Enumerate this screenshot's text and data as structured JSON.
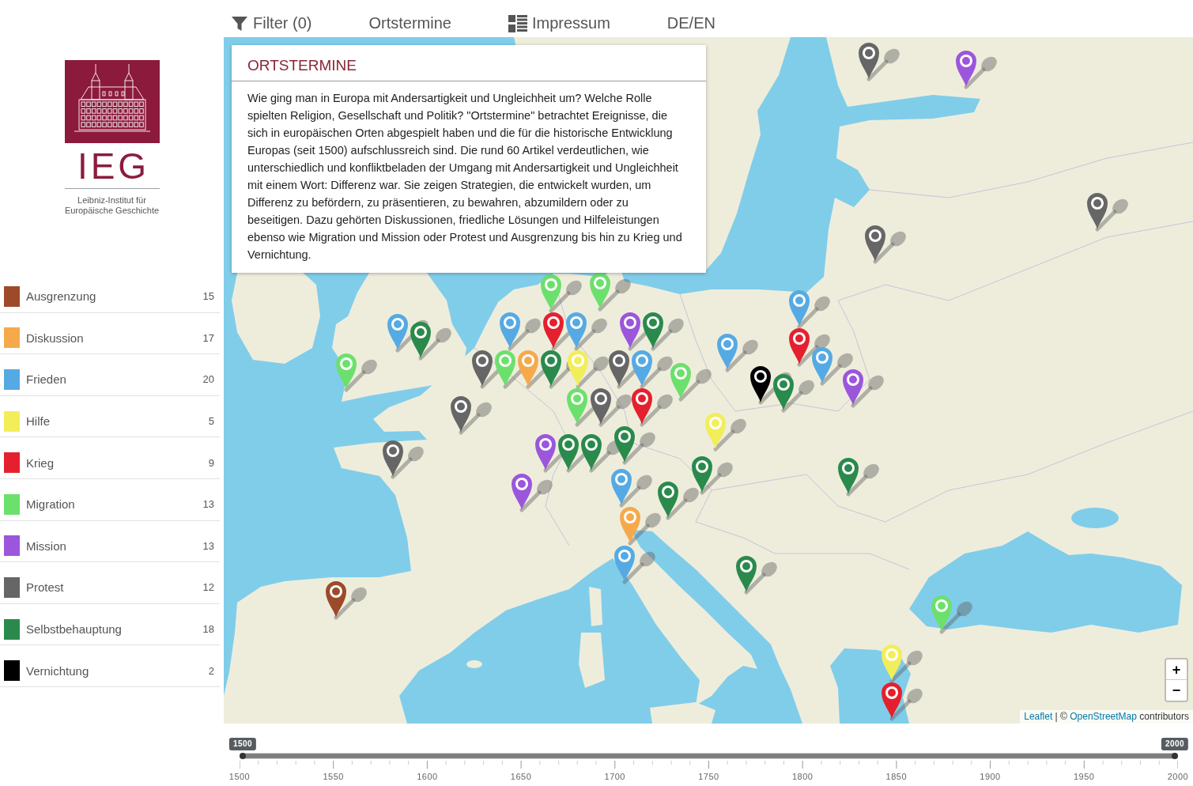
{
  "logo": {
    "wordmark": "IEG",
    "subtitle": "Leibniz-Institut für Europäische Geschichte"
  },
  "nav": [
    {
      "label": "Filter (0)",
      "kind": "filter"
    },
    {
      "label": "Ortstermine",
      "kind": "link"
    },
    {
      "label": "Impressum",
      "kind": "impressum"
    },
    {
      "label": "DE/EN",
      "kind": "link"
    }
  ],
  "categories": [
    {
      "label": "Ausgrenzung",
      "count": "15",
      "color": "#9c4a2a"
    },
    {
      "label": "Diskussion",
      "count": "17",
      "color": "#f6a94b"
    },
    {
      "label": "Frieden",
      "count": "20",
      "color": "#55aae3"
    },
    {
      "label": "Hilfe",
      "count": "5",
      "color": "#f2ee5a"
    },
    {
      "label": "Krieg",
      "count": "9",
      "color": "#e5202e"
    },
    {
      "label": "Migration",
      "count": "13",
      "color": "#6ce06c"
    },
    {
      "label": "Mission",
      "count": "13",
      "color": "#9b56db"
    },
    {
      "label": "Protest",
      "count": "12",
      "color": "#666666"
    },
    {
      "label": "Selbstbehauptung",
      "count": "18",
      "color": "#2a8a4c"
    },
    {
      "label": "Vernichtung",
      "count": "2",
      "color": "#000000"
    }
  ],
  "intro_panel": {
    "title": "ORTSTERMINE",
    "text": "Wie ging man in Europa mit Andersartigkeit und Ungleichheit um? Welche Rolle spielten Religion, Gesellschaft und Politik? \"Ortstermine\" betrachtet Ereignisse, die sich in europäischen Orten abgespielt haben und die für die historische Entwicklung Europas (seit 1500) aufschlussreich sind. Die rund 60 Artikel verdeutlichen, wie unterschiedlich und konfliktbeladen der Umgang mit Andersartigkeit und Ungleichheit mit einem Wort: Differenz war. Sie zeigen Strategien, die entwickelt wurden, um Differenz zu befördern, zu präsentieren, zu bewahren, abzumildern oder zu beseitigen. Dazu gehörten Diskussionen, friedliche Lösungen und Hilfeleistungen ebenso wie Migration und Mission oder Protest und Ausgrenzung bis hin zu Krieg und Vernichtung."
  },
  "map": {
    "markers": [
      {
        "color": "#666666"
      },
      {
        "color": "#9b56db"
      },
      {
        "color": "#666666"
      },
      {
        "color": "#666666"
      },
      {
        "color": "#6ce06c"
      },
      {
        "color": "#6ce06c"
      },
      {
        "color": "#e5202e"
      },
      {
        "color": "#55aae3"
      },
      {
        "color": "#55aae3"
      },
      {
        "color": "#9b56db"
      },
      {
        "color": "#2a8a4c"
      },
      {
        "color": "#e5202e"
      },
      {
        "color": "#55aae3"
      },
      {
        "color": "#55aae3"
      },
      {
        "color": "#2a8a4c"
      },
      {
        "color": "#6ce06c"
      },
      {
        "color": "#666666"
      },
      {
        "color": "#6ce06c"
      },
      {
        "color": "#f6a94b"
      },
      {
        "color": "#2a8a4c"
      },
      {
        "color": "#55aae3"
      },
      {
        "color": "#666666"
      },
      {
        "color": "#55aae3"
      },
      {
        "color": "#e5202e"
      },
      {
        "color": "#55aae3"
      },
      {
        "color": "#6ce06c"
      },
      {
        "color": "#f2ee5a"
      },
      {
        "color": "#666666"
      },
      {
        "color": "#6ce06c"
      },
      {
        "color": "#000000"
      },
      {
        "color": "#2a8a4c"
      },
      {
        "color": "#9b56db"
      },
      {
        "color": "#666666"
      },
      {
        "color": "#2a8a4c"
      },
      {
        "color": "#f2ee5a"
      },
      {
        "color": "#666666"
      },
      {
        "color": "#9b56db"
      },
      {
        "color": "#2a8a4c"
      },
      {
        "color": "#2a8a4c"
      },
      {
        "color": "#9b56db"
      },
      {
        "color": "#55aae3"
      },
      {
        "color": "#2a8a4c"
      },
      {
        "color": "#2a8a4c"
      },
      {
        "color": "#2a8a4c"
      },
      {
        "color": "#f6a94b"
      },
      {
        "color": "#55aae3"
      },
      {
        "color": "#2a8a4c"
      },
      {
        "color": "#9c4a2a"
      },
      {
        "color": "#6ce06c"
      },
      {
        "color": "#f2ee5a"
      },
      {
        "color": "#e5202e"
      }
    ],
    "zoom_controls": [
      "+",
      "−"
    ],
    "attribution": [
      {
        "text": "Leaflet",
        "kind": "link"
      },
      {
        "text": "| ©",
        "kind": "text"
      },
      {
        "text": "OpenStreetMap",
        "kind": "link"
      },
      {
        "text": "contributors",
        "kind": "text"
      }
    ]
  },
  "timeline": {
    "handles": [
      {
        "label": "1500",
        "level": 0
      },
      {
        "label": "2000",
        "level": 1
      }
    ],
    "ticks": [
      "1500",
      "1550",
      "1600",
      "1650",
      "1700",
      "1750",
      "1800",
      "1850",
      "1900",
      "1950",
      "2000"
    ]
  }
}
